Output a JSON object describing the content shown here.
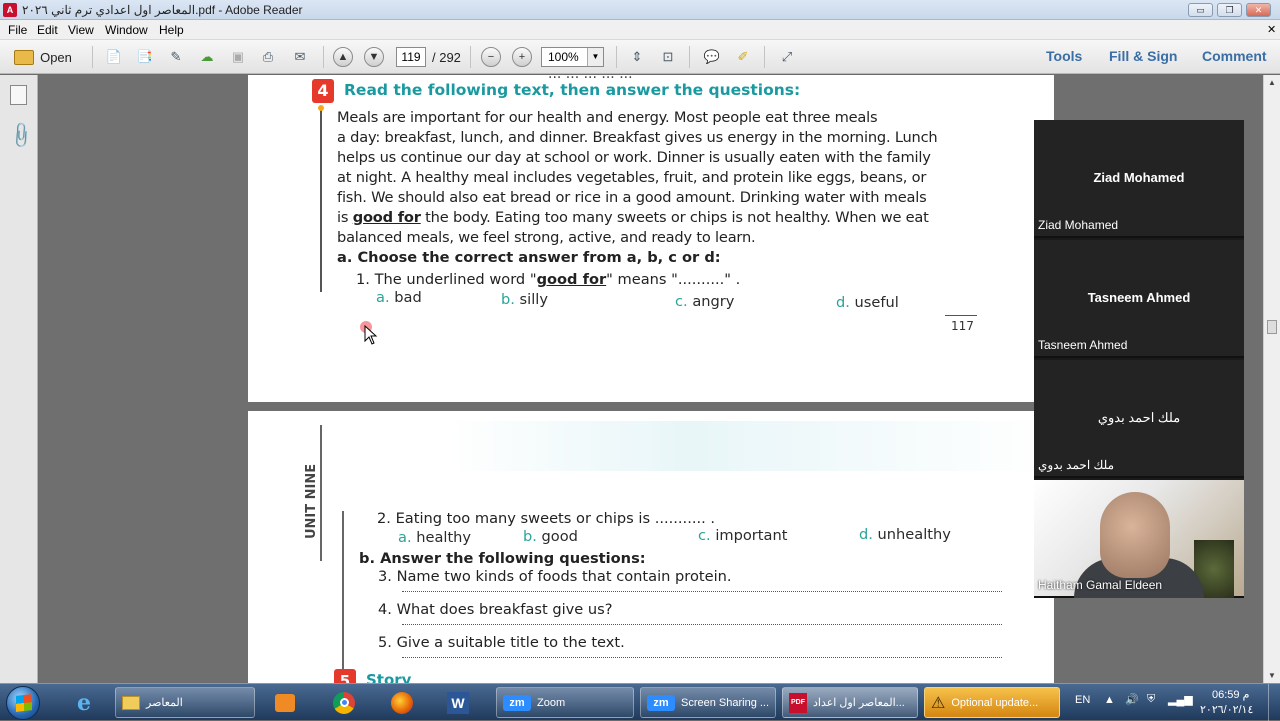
{
  "window": {
    "title": "المعاصر اول اعدادي ترم ثاني ٢٠٢٦.pdf - Adobe Reader",
    "min": "▭",
    "max": "❐",
    "close": "✕"
  },
  "menu": [
    "File",
    "Edit",
    "View",
    "Window",
    "Help"
  ],
  "toolbar": {
    "open_label": "Open",
    "page_current": "119",
    "page_total": "/ 292",
    "zoom": "100%",
    "tools": "Tools",
    "fill_sign": "Fill & Sign",
    "comment": "Comment"
  },
  "page1": {
    "top_cut": "... ... ... ... ...",
    "section_number": "4",
    "heading": "Read the following text, then answer the questions:",
    "paragraph": [
      "    Meals are important for our health and energy. Most people eat three meals",
      "a day: breakfast, lunch, and dinner. Breakfast gives us energy in the morning. Lunch",
      "helps us continue our day at school or work. Dinner is usually eaten with the family",
      "at night. A healthy meal includes vegetables, fruit, and protein like eggs, beans, or",
      "fish. We should also eat bread or rice in a good amount. Drinking water with meals",
      "the body. Eating too many sweets or chips is not healthy. When we eat",
      "balanced meals, we feel strong, active, and ready to learn."
    ],
    "para_line6_prefix": "is ",
    "underlined": "good for",
    "part_a": "a. Choose the correct answer from a, b, c or d:",
    "q1_pre": "1. The underlined word \"",
    "q1_post": "\" means \"..........\" .",
    "q1_options": [
      {
        "letter": "a.",
        "text": "bad"
      },
      {
        "letter": "b.",
        "text": "silly"
      },
      {
        "letter": "c.",
        "text": "angry"
      },
      {
        "letter": "d.",
        "text": "useful"
      }
    ],
    "page_number": "117"
  },
  "page2": {
    "unit_label": "UNIT NINE",
    "q2": "2. Eating too many sweets or chips is ........... .",
    "q2_options": [
      {
        "letter": "a.",
        "text": "healthy"
      },
      {
        "letter": "b.",
        "text": "good"
      },
      {
        "letter": "c.",
        "text": "important"
      },
      {
        "letter": "d.",
        "text": "unhealthy"
      }
    ],
    "part_b": "b. Answer the following questions:",
    "q3": "3. Name two kinds of foods that contain protein.",
    "q4": "4. What does breakfast give us?",
    "q5": "5. Give a suitable title to the text.",
    "next_number": "5",
    "next_heading": "Story"
  },
  "participants": [
    {
      "big": "Ziad Mohamed",
      "small": "Ziad Mohamed"
    },
    {
      "big": "Tasneem Ahmed",
      "small": "Tasneem Ahmed"
    },
    {
      "big": "ملك احمد بدوي",
      "small": "ملك احمد بدوي"
    },
    {
      "big": "",
      "small": "Haitham Gamal Eldeen"
    }
  ],
  "taskbar": {
    "folder_label": "المعاصر",
    "zoom_label": "Zoom",
    "screen_sharing": "Screen Sharing ...",
    "pdf_label": "المعاصر اول اعداد...",
    "update_label": "Optional update...",
    "lang": "EN",
    "time": "06:59 م",
    "date": "٢٠٢٦/٠٢/١٤"
  }
}
